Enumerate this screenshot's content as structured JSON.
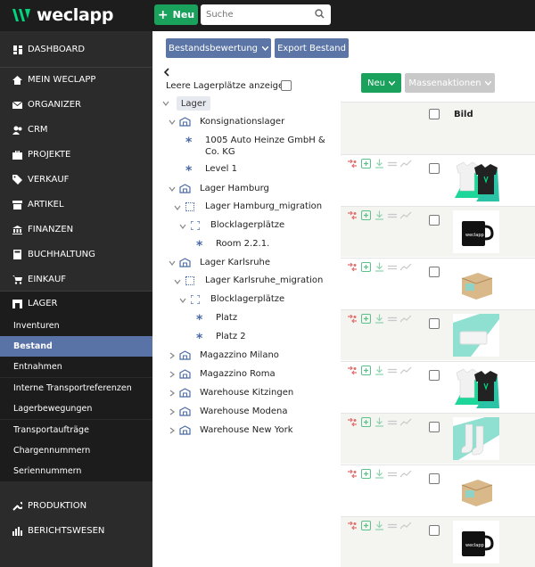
{
  "app": {
    "logo_text": "weclapp"
  },
  "topbar": {
    "new_label": "Neu",
    "search_placeholder": "Suche"
  },
  "sidebar": {
    "items": [
      {
        "label": "DASHBOARD",
        "icon": "dashboard-icon"
      },
      {
        "label": "MEIN WECLAPP",
        "icon": "home-icon"
      },
      {
        "label": "ORGANIZER",
        "icon": "mail-icon"
      },
      {
        "label": "CRM",
        "icon": "contacts-icon"
      },
      {
        "label": "PROJEKTE",
        "icon": "briefcase-icon"
      },
      {
        "label": "VERKAUF",
        "icon": "tag-icon"
      },
      {
        "label": "ARTIKEL",
        "icon": "box-icon"
      },
      {
        "label": "FINANZEN",
        "icon": "bank-icon"
      },
      {
        "label": "BUCHHALTUNG",
        "icon": "calculator-icon"
      },
      {
        "label": "EINKAUF",
        "icon": "cart-icon"
      },
      {
        "label": "LAGER",
        "icon": "warehouse-icon"
      }
    ],
    "lager_sub": [
      "Inventuren",
      "Bestand",
      "Entnahmen",
      "Interne Transportreferenzen",
      "Lagerbewegungen",
      "Transportaufträge",
      "Chargennummern",
      "Seriennummern"
    ],
    "bottom_items": [
      {
        "label": "PRODUKTION",
        "icon": "wrench-icon"
      },
      {
        "label": "BERICHTSWESEN",
        "icon": "bar-chart-icon"
      }
    ]
  },
  "toolbar": {
    "bestandsbewertung": "Bestandsbewertung",
    "export": "Export Bestand"
  },
  "tree": {
    "empty_toggle_label": "Leere Lagerplätze anzeigen",
    "root": "Lager",
    "nodes": [
      "Konsignationslager",
      "1005 Auto Heinze GmbH &",
      "Co. KG",
      "Level 1",
      "Lager Hamburg",
      "Lager Hamburg_migration",
      "Blocklagerplätze",
      "Room 2.2.1.",
      "Lager Karlsruhe",
      "Lager Karlsruhe_migration",
      "Blocklagerplätze",
      "Platz",
      "Platz 2",
      "Magazzino Milano",
      "Magazzino Roma",
      "Warehouse Kitzingen",
      "Warehouse Modena",
      "Warehouse New York"
    ]
  },
  "list": {
    "new_label": "Neu",
    "mass_actions_label": "Massenaktionen",
    "col_image": "Bild",
    "rows": [
      {
        "image": "tshirt-image"
      },
      {
        "image": "mug-image"
      },
      {
        "image": "box-image"
      },
      {
        "image": "card-image"
      },
      {
        "image": "tshirt-image"
      },
      {
        "image": "socks-image"
      },
      {
        "image": "box-image"
      },
      {
        "image": "mug-image"
      }
    ]
  },
  "colors": {
    "accent_green": "#1aa15b",
    "accent_blue": "#5b75a6",
    "sidebar_bg": "#2b2b2b",
    "topbar_bg": "#1d1d1d"
  }
}
